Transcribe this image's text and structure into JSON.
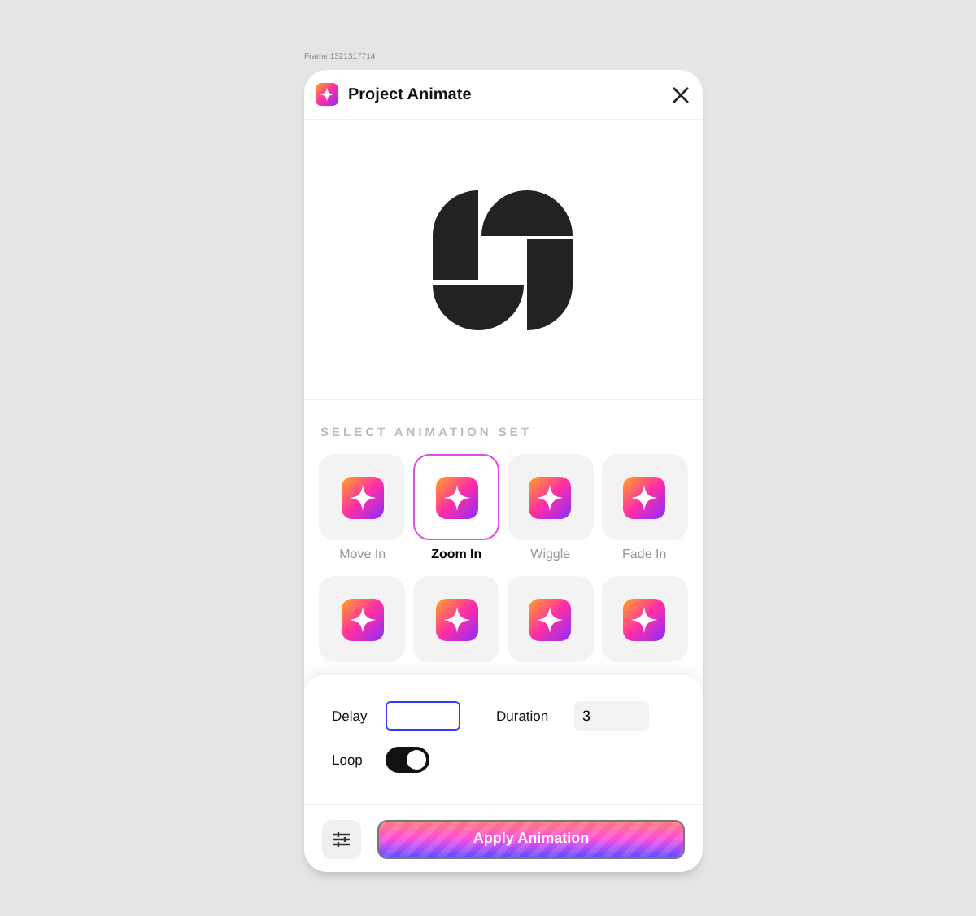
{
  "frame_label": "Frame 1321317714",
  "window": {
    "title": "Project Animate"
  },
  "section_title": "SELECT ANIMATION SET",
  "animations": [
    {
      "label": "Move In",
      "selected": false
    },
    {
      "label": "Zoom In",
      "selected": true
    },
    {
      "label": "Wiggle",
      "selected": false
    },
    {
      "label": "Fade In",
      "selected": false
    },
    {
      "selected": false
    },
    {
      "selected": false
    },
    {
      "selected": false
    },
    {
      "selected": false
    }
  ],
  "settings": {
    "delay": {
      "label": "Delay",
      "focused": true
    },
    "duration": {
      "label": "Duration",
      "value": "3",
      "focused": false
    },
    "loop": {
      "label": "Loop",
      "on": true
    }
  },
  "apply_button": "Apply Animation"
}
